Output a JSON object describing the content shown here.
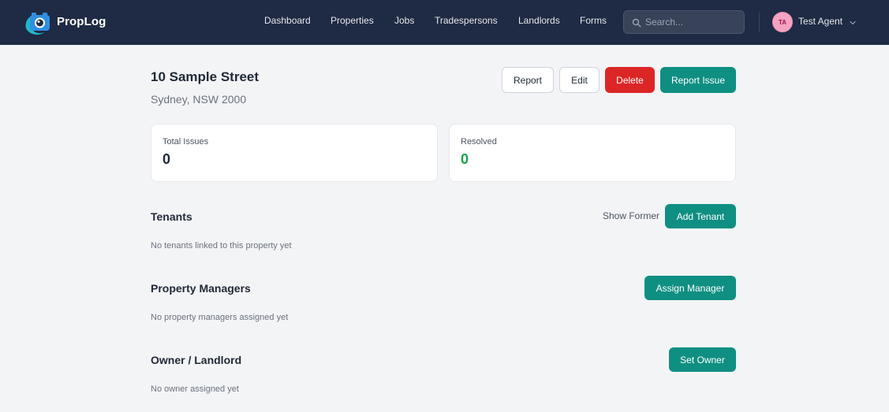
{
  "app": {
    "brand": "PropLog"
  },
  "nav": {
    "items": [
      {
        "label": "Dashboard"
      },
      {
        "label": "Properties"
      },
      {
        "label": "Jobs"
      },
      {
        "label": "Tradespersons"
      },
      {
        "label": "Landlords"
      },
      {
        "label": "Forms"
      }
    ]
  },
  "search": {
    "placeholder": "Search..."
  },
  "user": {
    "initials": "TA",
    "name": "Test Agent"
  },
  "property": {
    "title": "10 Sample Street",
    "address": "Sydney, NSW 2000"
  },
  "actions": {
    "report": "Report",
    "edit": "Edit",
    "delete": "Delete",
    "report_issue": "Report Issue"
  },
  "stats": {
    "total_issues": {
      "label": "Total Issues",
      "value": "0"
    },
    "resolved": {
      "label": "Resolved",
      "value": "0"
    }
  },
  "tenants": {
    "title": "Tenants",
    "show_former": "Show Former",
    "add_button": "Add Tenant",
    "empty": "No tenants linked to this property yet"
  },
  "managers": {
    "title": "Property Managers",
    "assign_button": "Assign Manager",
    "empty": "No property managers assigned yet"
  },
  "owner": {
    "title": "Owner / Landlord",
    "set_button": "Set Owner",
    "empty": "No owner assigned yet"
  },
  "colors": {
    "header_bg": "#1f2a44",
    "primary": "#0f8f82",
    "danger": "#dc2626",
    "success": "#16a34a",
    "page_bg": "#f3f4f6"
  }
}
